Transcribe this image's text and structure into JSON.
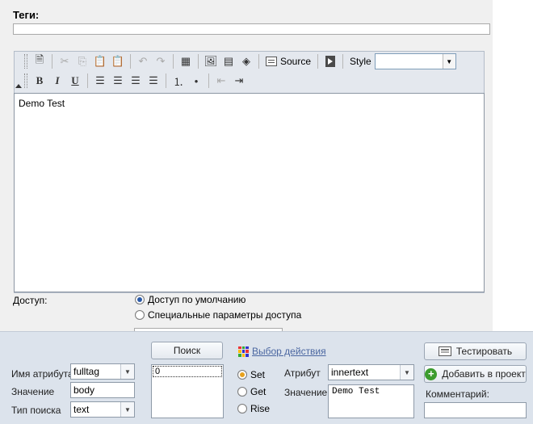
{
  "page": {
    "tags_label": "Теги:",
    "tags_value": "",
    "editor": {
      "source_label": "Source",
      "style_label": "Style",
      "style_value": "",
      "content": "Demo Test"
    },
    "access": {
      "label": "Доступ:",
      "options": [
        "Доступ по умолчанию",
        "Специальные параметры доступа"
      ],
      "selected": "Доступ по умолчанию"
    }
  },
  "panel": {
    "attr_name_label": "Имя атрибута",
    "attr_name_value": "fulltag",
    "value_label": "Значение",
    "value_value": "body",
    "search_type_label": "Тип поиска",
    "search_type_value": "text",
    "search_button": "Поиск",
    "results": [
      "0"
    ],
    "action_link": "Выбор действия",
    "modes": [
      "Set",
      "Get",
      "Rise"
    ],
    "mode_selected": "Set",
    "attribute_label": "Атрибут",
    "attribute_value": "innertext",
    "value2_label": "Значение",
    "value2_text": "Demo Test",
    "test_button": "Тестировать",
    "add_button": "Добавить в проект",
    "comment_label": "Комментарий:",
    "comment_value": ""
  }
}
